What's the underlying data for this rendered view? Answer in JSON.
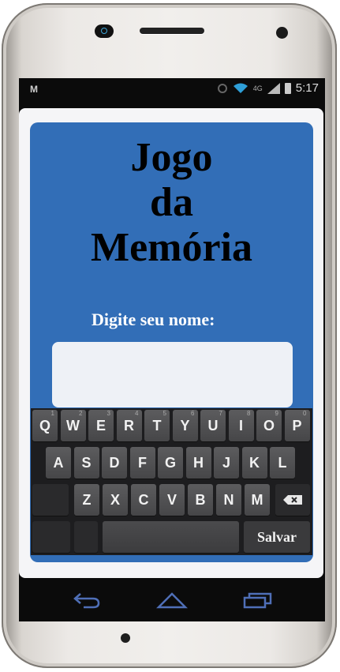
{
  "status_bar": {
    "time": "5:17",
    "network": "4G",
    "logo": "M"
  },
  "app": {
    "title_lines": [
      "Jogo",
      "da",
      "Memória"
    ],
    "name_prompt": "Digite seu nome:",
    "name_value": "",
    "save_label": "Salvar"
  },
  "keyboard": {
    "row1": [
      {
        "key": "Q",
        "hint": "1"
      },
      {
        "key": "W",
        "hint": "2"
      },
      {
        "key": "E",
        "hint": "3"
      },
      {
        "key": "R",
        "hint": "4"
      },
      {
        "key": "T",
        "hint": "5"
      },
      {
        "key": "Y",
        "hint": "6"
      },
      {
        "key": "U",
        "hint": "7"
      },
      {
        "key": "I",
        "hint": "8"
      },
      {
        "key": "O",
        "hint": "9"
      },
      {
        "key": "P",
        "hint": "0"
      }
    ],
    "row2": [
      "A",
      "S",
      "D",
      "F",
      "G",
      "H",
      "J",
      "K",
      "L"
    ],
    "row3": [
      "Z",
      "X",
      "C",
      "V",
      "B",
      "N",
      "M"
    ]
  },
  "colors": {
    "panel": "#326eb7",
    "dialog": "#f5f5f7",
    "input": "#eef1f6",
    "nav_icon": "#4f6fb7"
  },
  "icons": [
    "back-icon",
    "home-icon",
    "recents-icon",
    "backspace-icon",
    "wifi-icon",
    "signal-icon",
    "battery-icon"
  ]
}
